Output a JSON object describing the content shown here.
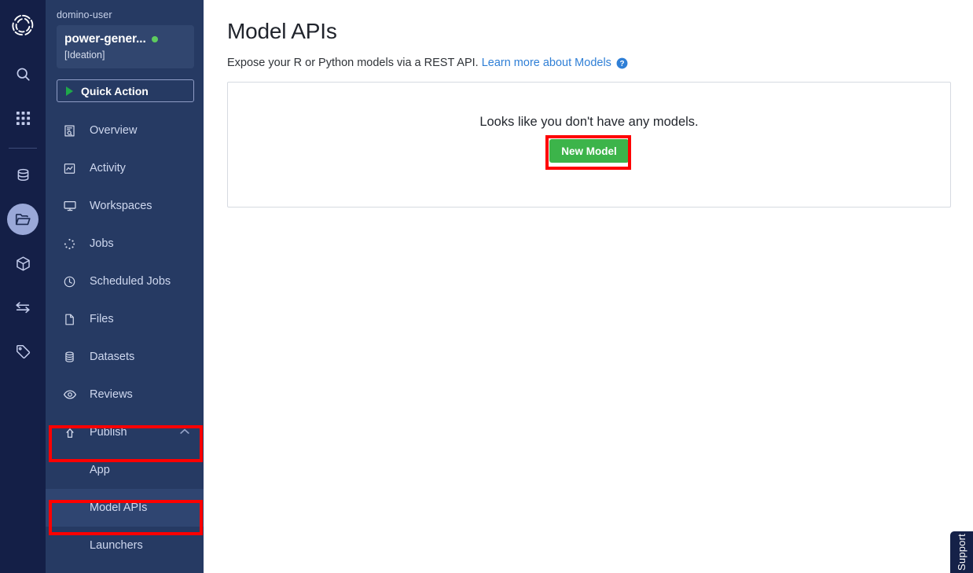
{
  "icon_rail": {
    "logo": "domino-aperture-logo-icon",
    "items": [
      {
        "name": "search-icon",
        "active": false
      },
      {
        "name": "grid-apps-icon",
        "active": false
      },
      {
        "name": "database-icon",
        "active": false
      },
      {
        "name": "folder-projects-icon",
        "active": true
      },
      {
        "name": "cube-environments-icon",
        "active": false
      },
      {
        "name": "transfer-arrows-icon",
        "active": false
      },
      {
        "name": "tag-icon",
        "active": false
      }
    ]
  },
  "sidebar": {
    "owner": "domino-user",
    "project_name": "power-gener...",
    "project_status": "active",
    "project_stage": "[Ideation]",
    "quick_action_label": "Quick Action",
    "items": [
      {
        "label": "Overview",
        "icon": "overview-document-icon",
        "type": "item",
        "selected": false
      },
      {
        "label": "Activity",
        "icon": "activity-chart-icon",
        "type": "item",
        "selected": false
      },
      {
        "label": "Workspaces",
        "icon": "monitor-icon",
        "type": "item",
        "selected": false
      },
      {
        "label": "Jobs",
        "icon": "spinner-dots-icon",
        "type": "item",
        "selected": false
      },
      {
        "label": "Scheduled Jobs",
        "icon": "clock-icon",
        "type": "item",
        "selected": false
      },
      {
        "label": "Files",
        "icon": "file-icon",
        "type": "item",
        "selected": false
      },
      {
        "label": "Datasets",
        "icon": "datasets-stack-icon",
        "type": "item",
        "selected": false
      },
      {
        "label": "Reviews",
        "icon": "eye-icon",
        "type": "item",
        "selected": false
      },
      {
        "label": "Publish",
        "icon": "publish-upload-icon",
        "type": "item",
        "selected": false,
        "expanded": true,
        "chevron": "chevron-up-icon"
      },
      {
        "label": "App",
        "icon": "",
        "type": "sub",
        "selected": false
      },
      {
        "label": "Model APIs",
        "icon": "",
        "type": "sub",
        "selected": true
      },
      {
        "label": "Launchers",
        "icon": "",
        "type": "sub",
        "selected": false
      }
    ]
  },
  "main": {
    "title": "Model APIs",
    "subtitle_text": "Expose your R or Python models via a REST API.",
    "subtitle_link": "Learn more about Models",
    "help_icon": "question-circle-icon",
    "empty_message": "Looks like you don't have any models.",
    "new_model_label": "New Model"
  },
  "support": {
    "label": "Support"
  },
  "annotations": [
    {
      "name": "annotation-box-publish",
      "color": "#fe0000"
    },
    {
      "name": "annotation-box-model-apis",
      "color": "#fe0000"
    },
    {
      "name": "annotation-box-new-model",
      "color": "#fe0000"
    }
  ],
  "colors": {
    "rail_bg": "#141f47",
    "sidebar_bg": "#263a63",
    "sidebar_selected": "#2f4571",
    "project_card_bg": "#31466f",
    "accent_green": "#3cb44a",
    "status_dot_green": "#5ecb5e",
    "link_blue": "#2f7fd6",
    "annotation_red": "#fe0000"
  }
}
